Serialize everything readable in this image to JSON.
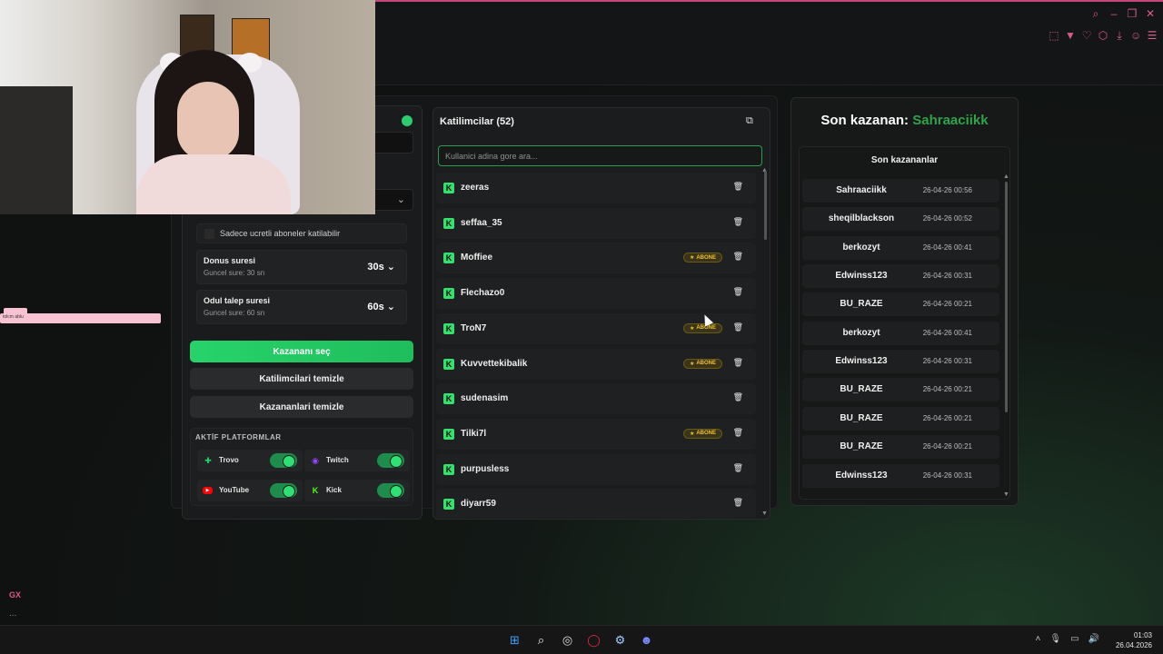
{
  "browser": {
    "window_icons": [
      "search-icon",
      "minimize-icon",
      "restore-icon",
      "close-icon"
    ],
    "toolbar_icons": [
      "snapshot-icon",
      "pocket-icon",
      "heart-icon",
      "extensions-icon",
      "download-icon",
      "account-icon",
      "menu-icon"
    ],
    "sidebar_gx": "GX",
    "sidebar_more": "...",
    "pink_tab_text": "tolcm ablu"
  },
  "settings": {
    "subs_only_label": "Sadece ucretli aboneler katilabilir",
    "spin_title": "Donus suresi",
    "spin_sub": "Guncel sure: 30 sn",
    "spin_value": "30s",
    "claim_title": "Odul talep suresi",
    "claim_sub": "Guncel sure: 60 sn",
    "claim_value": "60s"
  },
  "buttons": {
    "pick_winner": "Kazananı seç",
    "clear_participants": "Katilimcilari temizle",
    "clear_winners": "Kazananlari temizle"
  },
  "platforms": {
    "heading": "AKTİF PLATFORMLAR",
    "items": [
      {
        "name": "Trovo",
        "icon": "trovo-icon",
        "color": "#1fd66c",
        "enabled": true
      },
      {
        "name": "Twitch",
        "icon": "twitch-icon",
        "color": "#9146ff",
        "enabled": true
      },
      {
        "name": "YouTube",
        "icon": "youtube-icon",
        "color": "#ff0000",
        "enabled": true
      },
      {
        "name": "Kick",
        "icon": "kick-icon",
        "color": "#53fc18",
        "enabled": true
      }
    ]
  },
  "participants": {
    "title": "Katilimcilar (52)",
    "search_placeholder": "Kullanici adina gore ara...",
    "badge_label": "ABONE",
    "list": [
      {
        "name": "zeeras",
        "sub": false
      },
      {
        "name": "seffaa_35",
        "sub": false
      },
      {
        "name": "Moffiee",
        "sub": true
      },
      {
        "name": "Flechazo0",
        "sub": false
      },
      {
        "name": "TroN7",
        "sub": true
      },
      {
        "name": "Kuvvettekibalik",
        "sub": true
      },
      {
        "name": "sudenasim",
        "sub": false
      },
      {
        "name": "Tilki7l",
        "sub": true
      },
      {
        "name": "purpusless",
        "sub": false
      },
      {
        "name": "diyarr59",
        "sub": false
      }
    ]
  },
  "winners": {
    "title_prefix": "Son kazanan:",
    "last_winner": "Sahraaciikk",
    "history_title": "Son kazananlar",
    "history": [
      {
        "user": "Sahraaciikk",
        "date": "26-04-26 00:56"
      },
      {
        "user": "sheqilblackson",
        "date": "26-04-26 00:52"
      },
      {
        "user": "berkozyt",
        "date": "26-04-26 00:41"
      },
      {
        "user": "Edwinss123",
        "date": "26-04-26 00:31"
      },
      {
        "user": "BU_RAZE",
        "date": "26-04-26 00:21"
      },
      {
        "user": "berkozyt",
        "date": "26-04-26 00:41"
      },
      {
        "user": "Edwinss123",
        "date": "26-04-26 00:31"
      },
      {
        "user": "BU_RAZE",
        "date": "26-04-26 00:21"
      },
      {
        "user": "BU_RAZE",
        "date": "26-04-26 00:21"
      },
      {
        "user": "BU_RAZE",
        "date": "26-04-26 00:21"
      },
      {
        "user": "Edwinss123",
        "date": "26-04-26 00:31"
      }
    ]
  },
  "taskbar": {
    "apps": [
      "windows-start-icon",
      "search-icon",
      "obs-icon",
      "opera-gx-icon",
      "settings-app-icon",
      "discord-icon"
    ],
    "time": "01:03",
    "date": "26.04.2026"
  }
}
